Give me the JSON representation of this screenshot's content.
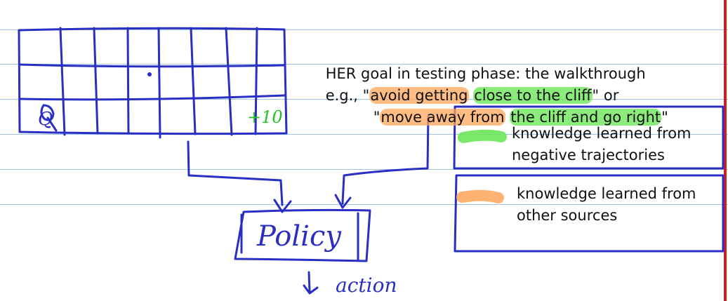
{
  "colors": {
    "ink": "#2a2fc4",
    "green_highlight": "#6ee65a",
    "orange_highlight": "#ffa65a",
    "ruled_line": "#9ec3e6",
    "margin_line": "#cc1f1f",
    "reward_text": "#22c322"
  },
  "grid": {
    "agent_label": "Q",
    "reward_label": "+10"
  },
  "notes": {
    "line1": "HER goal in testing phase: the walkthrough",
    "line2_prefix": "e.g., \"",
    "line2_orange": "avoid getting",
    "line2_space": " ",
    "line2_green": "close to the cliff",
    "line2_suffix": "\" or",
    "line3_prefix": "\"",
    "line3_orange": "move away from",
    "line3_space": " ",
    "line3_green": "the cliff and go right",
    "line3_suffix": "\""
  },
  "legend": {
    "green_line1": "knowledge learned from",
    "green_line2": "negative trajectories",
    "orange_line1": "knowledge learned from",
    "orange_line2": "other sources"
  },
  "policy": {
    "label": "Policy",
    "output_label": "action"
  }
}
